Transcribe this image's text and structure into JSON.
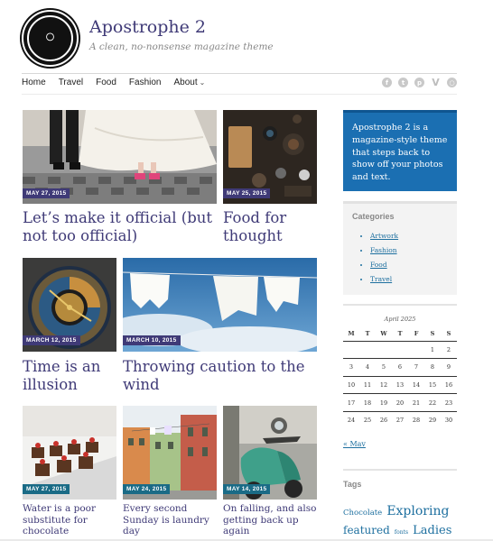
{
  "site": {
    "title": "Apostrophe 2",
    "tagline": "A clean, no-nonsense magazine theme"
  },
  "nav": {
    "items": [
      "Home",
      "Travel",
      "Food",
      "Fashion",
      "About"
    ]
  },
  "social": [
    "facebook-icon",
    "twitter-icon",
    "pinterest-icon",
    "vimeo-icon",
    "dribbble-icon"
  ],
  "posts": [
    {
      "date": "MAY 27, 2015",
      "title": "Let’s make it official (but not too official)"
    },
    {
      "date": "MAY 25, 2015",
      "title": "Food for thought"
    },
    {
      "date": "MARCH 12, 2015",
      "title": "Time is an illusion"
    },
    {
      "date": "MARCH 10, 2015",
      "title": "Throwing caution to the wind"
    },
    {
      "date": "MAY 27, 2015",
      "title": "Water is a poor substitute for chocolate"
    },
    {
      "date": "MAY 24, 2015",
      "title": "Every second Sunday is laundry day"
    },
    {
      "date": "MAY 14, 2015",
      "title": "On falling, and also getting back up again"
    }
  ],
  "sidebar": {
    "promo": "Apostrophe 2 is a magazine-style theme that steps back to show off your photos and text.",
    "categories": {
      "heading": "Categories",
      "items": [
        "Artwork",
        "Fashion",
        "Food",
        "Travel"
      ]
    },
    "calendar": {
      "caption": "April 2025",
      "days": [
        "M",
        "T",
        "W",
        "T",
        "F",
        "S",
        "S"
      ],
      "weeks": [
        [
          "",
          "",
          "",
          "",
          "",
          "1",
          "2"
        ],
        [
          "3",
          "4",
          "5",
          "6",
          "7",
          "8",
          "9"
        ],
        [
          "10",
          "11",
          "12",
          "13",
          "14",
          "15",
          "16"
        ],
        [
          "17",
          "18",
          "19",
          "20",
          "21",
          "22",
          "23"
        ],
        [
          "24",
          "25",
          "26",
          "27",
          "28",
          "29",
          "30"
        ]
      ],
      "prev": "« Mav"
    },
    "tags": {
      "heading": "Tags",
      "items": [
        "Chocolate",
        "Exploring",
        "featured",
        "fonts",
        "Ladies"
      ]
    }
  },
  "colors": {
    "accent": "#3f3a77",
    "link": "#1d6f9f",
    "promo_bg": "#1b6fb2",
    "date_badge": "#3f3a77",
    "date_badge_teal": "#1a6b86"
  }
}
